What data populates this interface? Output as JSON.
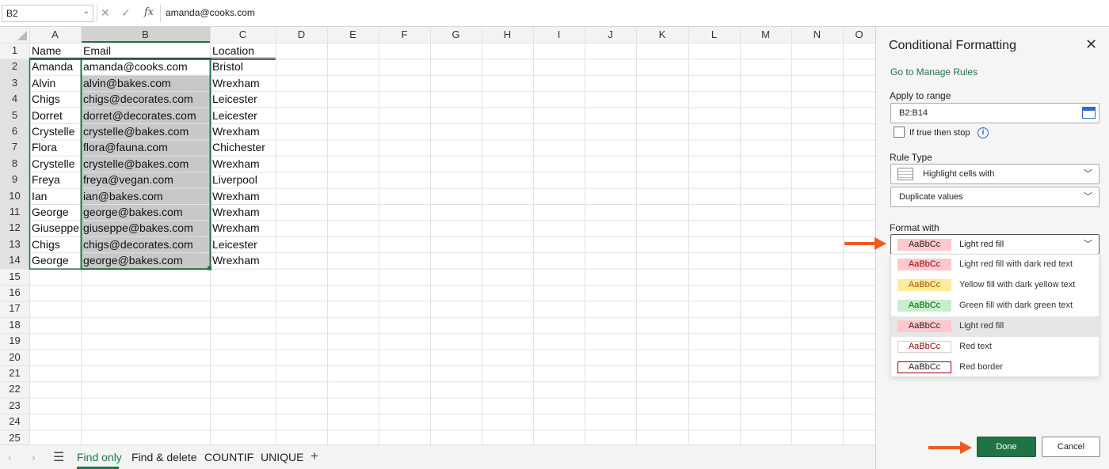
{
  "formula_bar": {
    "name_box": "B2",
    "cancel_icon": "close-icon",
    "enter_icon": "check-icon",
    "fx_label": "fx",
    "value": "amanda@cooks.com"
  },
  "grid": {
    "columns": [
      "A",
      "B",
      "C",
      "D",
      "E",
      "F",
      "G",
      "H",
      "I",
      "J",
      "K",
      "L",
      "M",
      "N",
      "O"
    ],
    "rows": [
      "1",
      "2",
      "3",
      "4",
      "5",
      "6",
      "7",
      "8",
      "9",
      "10",
      "11",
      "12",
      "13",
      "14",
      "15",
      "16",
      "17",
      "18",
      "19",
      "20",
      "21",
      "22",
      "23",
      "24",
      "25"
    ],
    "headers": [
      "Name",
      "Email",
      "Location"
    ],
    "data": [
      [
        "Amanda",
        "amanda@cooks.com",
        "Bristol"
      ],
      [
        "Alvin",
        "alvin@bakes.com",
        "Wrexham"
      ],
      [
        "Chigs",
        "chigs@decorates.com",
        "Leicester"
      ],
      [
        "Dorret",
        "dorret@decorates.com",
        "Leicester"
      ],
      [
        "Crystelle",
        "crystelle@bakes.com",
        "Wrexham"
      ],
      [
        "Flora",
        "flora@fauna.com",
        "Chichester"
      ],
      [
        "Crystelle",
        "crystelle@bakes.com",
        "Wrexham"
      ],
      [
        "Freya",
        "freya@vegan.com",
        "Liverpool"
      ],
      [
        "Ian",
        "ian@bakes.com",
        "Wrexham"
      ],
      [
        "George",
        "george@bakes.com",
        "Wrexham"
      ],
      [
        "Giuseppe",
        "giuseppe@bakes.com",
        "Wrexham"
      ],
      [
        "Chigs",
        "chigs@decorates.com",
        "Leicester"
      ],
      [
        "George",
        "george@bakes.com",
        "Wrexham"
      ]
    ],
    "selection_color": "#c8c8c8",
    "selection_border": "#217346"
  },
  "sheets": {
    "tabs": [
      "Find only",
      "Find & delete",
      "COUNTIF",
      "UNIQUE"
    ],
    "active": "Find only",
    "add_label": "+",
    "menu_icon": "hamburger-icon"
  },
  "panel": {
    "title": "Conditional Formatting",
    "close_label": "✕",
    "manage_rules_link": "Go to Manage Rules",
    "apply_to_range_label": "Apply to range",
    "apply_to_range_value": "B2:B14",
    "stop_if_true_label": "If true then stop",
    "rule_type_label": "Rule Type",
    "rule_type_value": "Highlight cells with",
    "rule_condition_value": "Duplicate values",
    "format_with_label": "Format with",
    "format_with_value": "Light red fill",
    "swatch_text": "AaBbCc",
    "format_options": [
      {
        "label": "Light red fill with dark red text",
        "fill": "#ffc7ce",
        "text": "#9c0006",
        "border": "#ffc7ce"
      },
      {
        "label": "Yellow fill with dark yellow text",
        "fill": "#ffeb9c",
        "text": "#9c5700",
        "border": "#ffeb9c"
      },
      {
        "label": "Green fill with dark green text",
        "fill": "#c6efce",
        "text": "#006100",
        "border": "#c6efce"
      },
      {
        "label": "Light red fill",
        "fill": "#ffc7ce",
        "text": "#222222",
        "border": "#ffc7ce"
      },
      {
        "label": "Red text",
        "fill": "#ffffff",
        "text": "#9c0006",
        "border": "#d0d0d0"
      },
      {
        "label": "Red border",
        "fill": "#ffffff",
        "text": "#222222",
        "border": "#9c0006"
      }
    ],
    "selected_option": "Light red fill",
    "done_label": "Done",
    "cancel_label": "Cancel",
    "accent_color": "#217346"
  },
  "annotations": {
    "arrow_color": "#f05a1e"
  }
}
